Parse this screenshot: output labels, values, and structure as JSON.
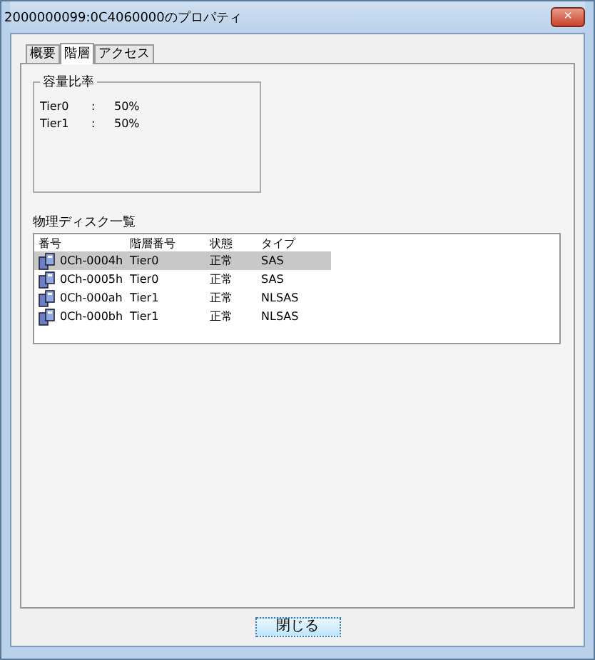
{
  "window": {
    "title": "2000000099:0C4060000のプロパティ",
    "close": "×"
  },
  "tabs": [
    {
      "label": "概要",
      "selected": false
    },
    {
      "label": "階層",
      "selected": true
    },
    {
      "label": "アクセス",
      "selected": false
    }
  ],
  "capacity": {
    "title": "容量比率",
    "rows": [
      {
        "name": "Tier0",
        "sep": ":",
        "value": "50%"
      },
      {
        "name": "Tier1",
        "sep": ":",
        "value": "50%"
      }
    ]
  },
  "disks": {
    "title": "物理ディスク一覧",
    "columns": [
      "番号",
      "階層番号",
      "状態",
      "タイプ"
    ],
    "rows": [
      {
        "cells": [
          "0Ch-0004h",
          "Tier0",
          "正常",
          "SAS"
        ],
        "selected": true
      },
      {
        "cells": [
          "0Ch-0005h",
          "Tier0",
          "正常",
          "SAS"
        ],
        "selected": false
      },
      {
        "cells": [
          "0Ch-000ah",
          "Tier1",
          "正常",
          "NLSAS"
        ],
        "selected": false
      },
      {
        "cells": [
          "0Ch-000bh",
          "Tier1",
          "正常",
          "NLSAS"
        ],
        "selected": false
      }
    ]
  },
  "buttons": [
    "閉じる"
  ]
}
